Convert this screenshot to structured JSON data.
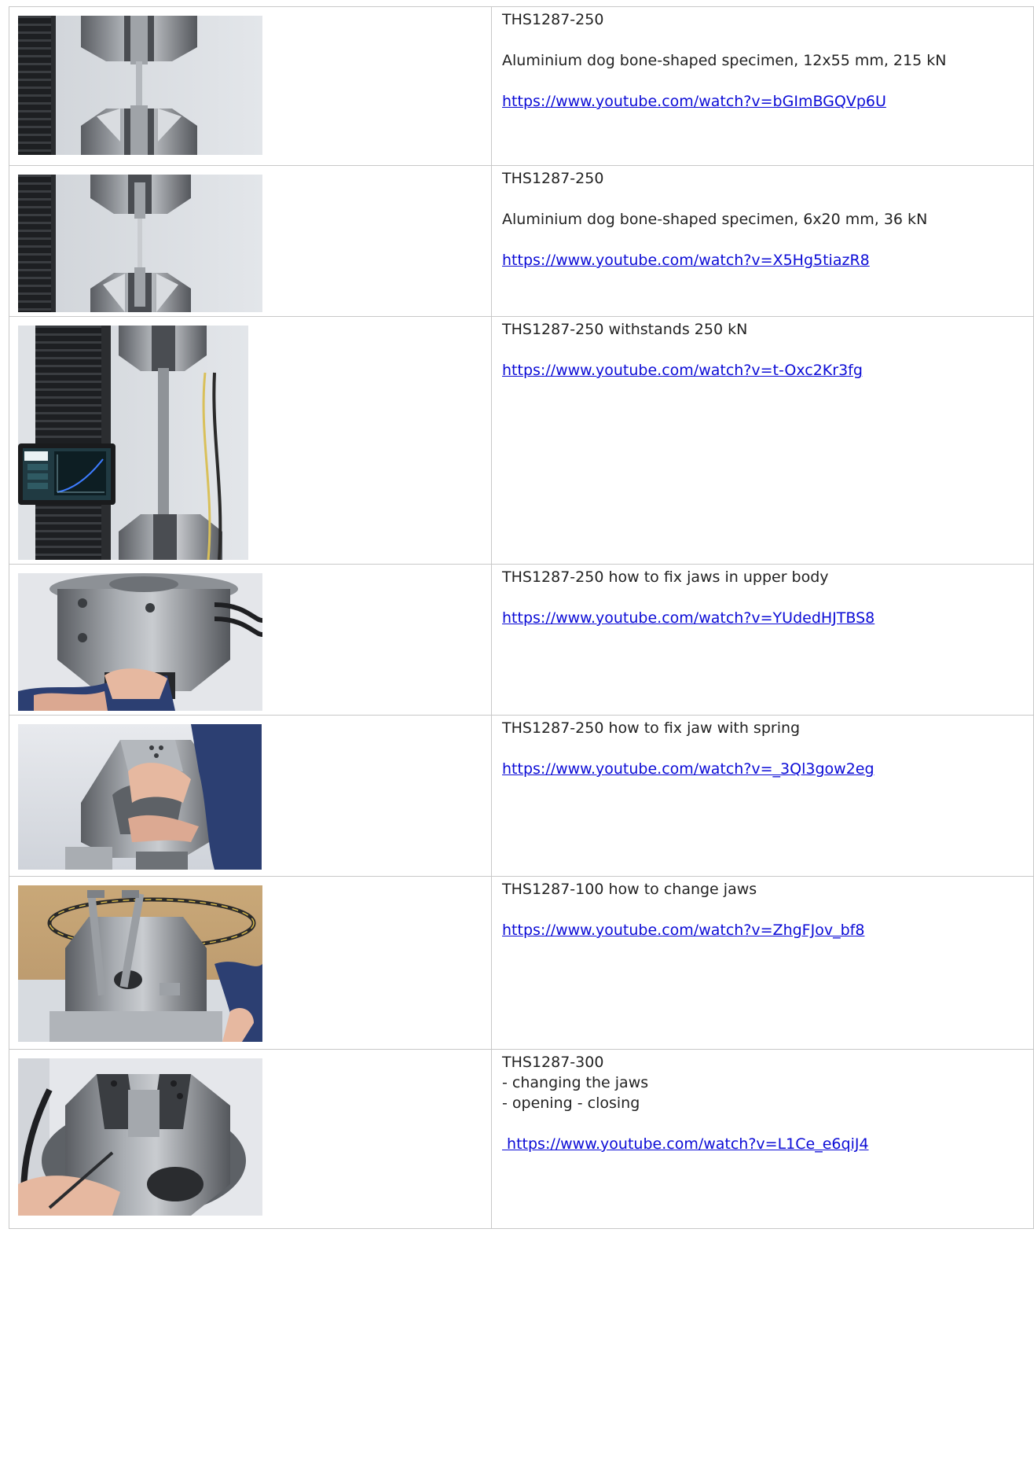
{
  "rows": [
    {
      "title": "THS1287-250",
      "description": "Aluminium dog bone-shaped specimen, 12x55 mm, 215 kN",
      "link": "https://www.youtube.com/watch?v=bGImBGQVp6U",
      "thumbnail_icon": "tensile-test-photo-icon"
    },
    {
      "title": "THS1287-250",
      "description": "Aluminium dog bone-shaped specimen, 6x20 mm, 36 kN",
      "link": "https://www.youtube.com/watch?v=X5Hg5tiazR8",
      "thumbnail_icon": "tensile-test-photo-icon"
    },
    {
      "title": "THS1287-250 withstands 250 kN",
      "link": "https://www.youtube.com/watch?v=t-Oxc2Kr3fg",
      "thumbnail_icon": "tensile-test-tablet-photo-icon"
    },
    {
      "title": "THS1287-250 how to fix jaws in upper body",
      "link": "https://www.youtube.com/watch?v=YUdedHJTBS8",
      "thumbnail_icon": "grip-body-photo-icon"
    },
    {
      "title": "THS1287-250 how to fix jaw with spring",
      "link": "https://www.youtube.com/watch?v=_3Ql3gow2eg",
      "thumbnail_icon": "jaw-spring-photo-icon"
    },
    {
      "title": "THS1287-100 how to change jaws",
      "link": "https://www.youtube.com/watch?v=ZhgFJov_bf8",
      "thumbnail_icon": "change-jaws-photo-icon"
    },
    {
      "title": "THS1287-300",
      "bullets": [
        " - changing the jaws",
        " - opening - closing"
      ],
      "link": " https://www.youtube.com/watch?v=L1Ce_e6qiJ4",
      "thumbnail_icon": "open-close-jaws-photo-icon"
    }
  ],
  "colors": {
    "link": "#0b0bd6",
    "border": "#c8c8c8",
    "text": "#222222"
  }
}
